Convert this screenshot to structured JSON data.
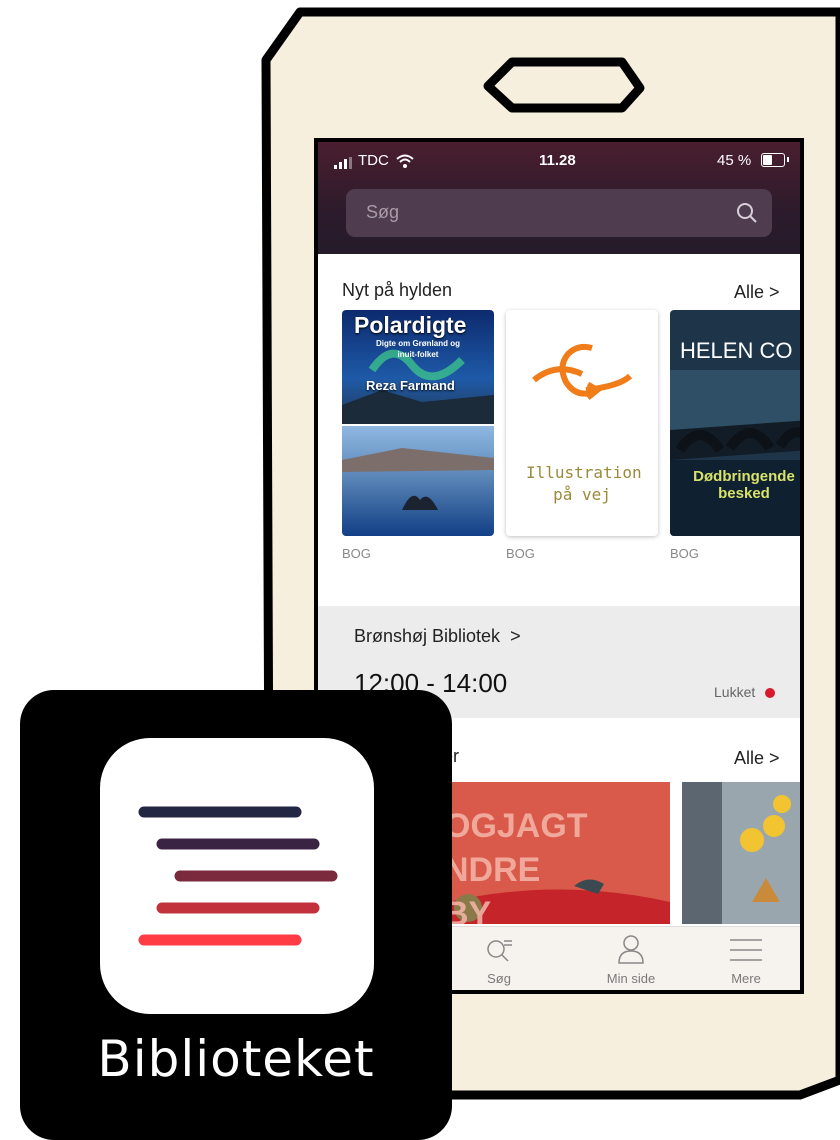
{
  "status_bar": {
    "carrier": "TDC",
    "time": "11.28",
    "battery_percent": "45 %",
    "battery_level": 0.45
  },
  "search": {
    "placeholder": "Søg"
  },
  "new_on_shelf": {
    "title": "Nyt på hylden",
    "all_label": "Alle >",
    "books": [
      {
        "type": "BOG",
        "title": "Polardigte",
        "subtitle": "Digte om Grønland og inuit-folket",
        "author": "Reza Farmand"
      },
      {
        "type": "BOG",
        "placeholder": "Illustration på vej"
      },
      {
        "type": "BOG",
        "author": "HELEN CO",
        "title": "Dødbringende besked"
      }
    ]
  },
  "library": {
    "name": "Brønshøj Bibliotek",
    "chevron": ">",
    "hours": "12:00 - 14:00",
    "status": "Lukket"
  },
  "events": {
    "title_fragment": "ter",
    "all_label": "Alle >",
    "poster_text": "OGJAGT NDRE BY"
  },
  "tabbar": {
    "tabs": [
      {
        "label": "Søg",
        "icon": "search-list-icon"
      },
      {
        "label": "Min side",
        "icon": "user-icon"
      },
      {
        "label": "Mere",
        "icon": "menu-icon"
      }
    ]
  },
  "app": {
    "name": "Biblioteket",
    "icon": "bibliotek-logo-icon"
  },
  "colors": {
    "frame_fill": "#f6efdd",
    "header": "#2d1b2c",
    "accent_orange": "#f07d1a",
    "closed_dot": "#d81b2c"
  }
}
